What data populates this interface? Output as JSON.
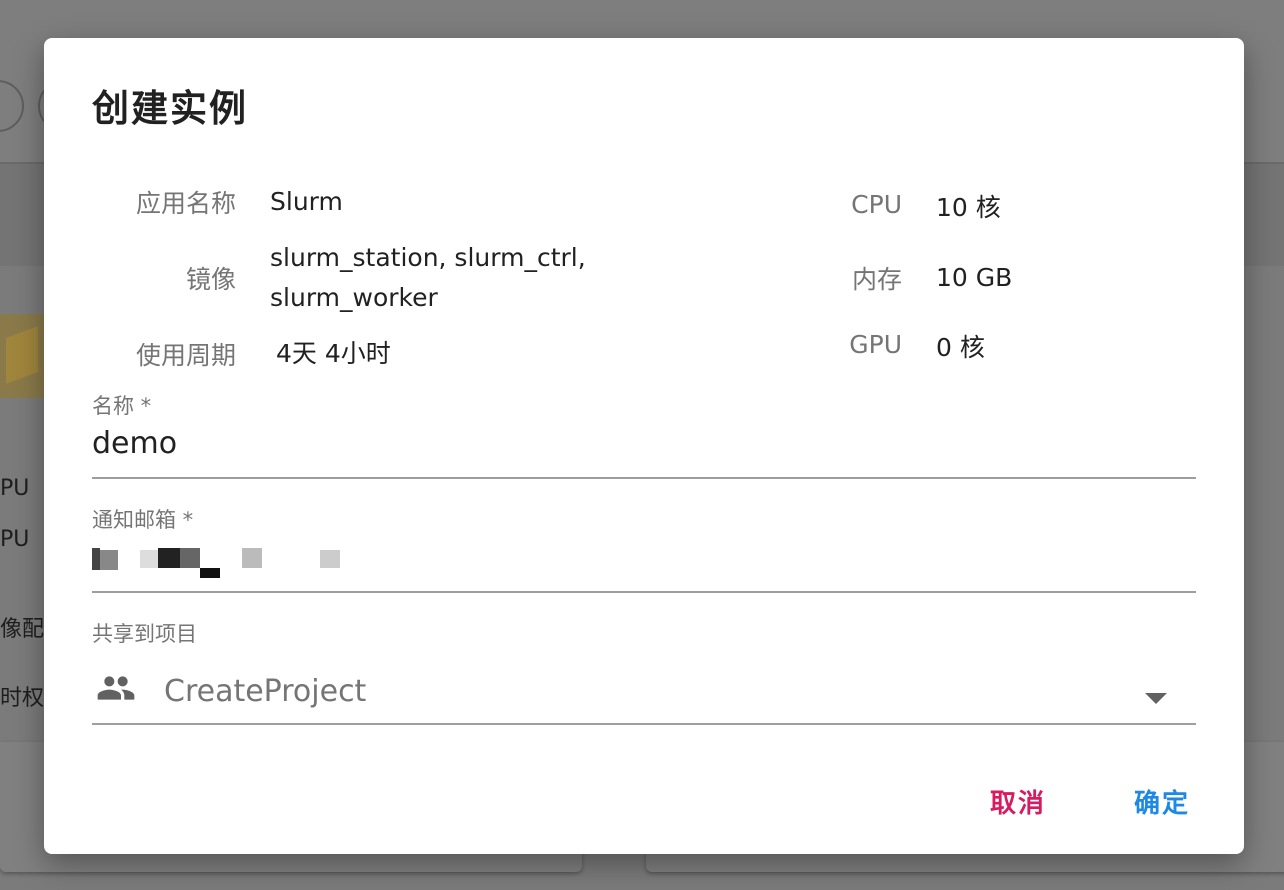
{
  "background": {
    "side_labels": [
      "PU",
      "PU",
      "像配",
      "时权"
    ]
  },
  "dialog": {
    "title": "创建实例",
    "info_left": [
      {
        "label": "应用名称",
        "value": "Slurm"
      },
      {
        "label": "镜像",
        "value_line1": "slurm_station, slurm_ctrl,",
        "value_line2": "slurm_worker"
      },
      {
        "label": "使用周期",
        "value": "4天 4小时"
      }
    ],
    "info_right": [
      {
        "label": "CPU",
        "value": "10 核"
      },
      {
        "label": "内存",
        "value": "10 GB"
      },
      {
        "label": "GPU",
        "value": "0 核"
      }
    ],
    "name_field": {
      "label": "名称 *",
      "value": "demo"
    },
    "email_field": {
      "label": "通知邮箱 *",
      "value": ""
    },
    "project_field": {
      "label": "共享到项目",
      "value": "CreateProject",
      "icon": "group-icon"
    },
    "buttons": {
      "cancel": "取消",
      "confirm": "确定"
    },
    "colors": {
      "cancel": "#d81b60",
      "confirm": "#1e88e5"
    }
  }
}
